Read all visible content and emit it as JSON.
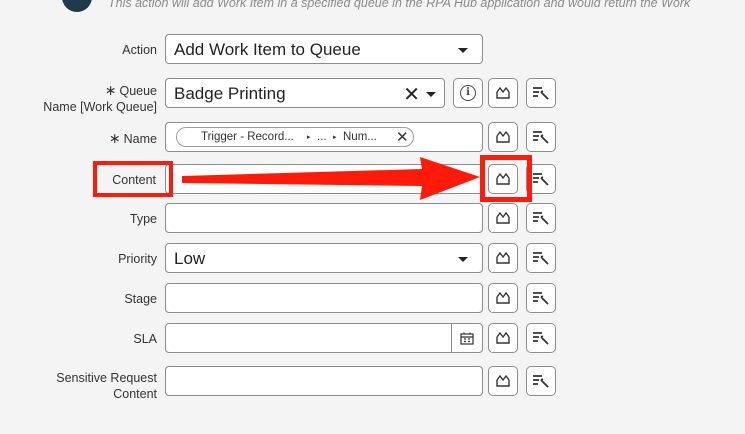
{
  "header": {
    "description": "This action will add Work Item in a specified queue in the RPA Hub application and would return the Work"
  },
  "form": {
    "action": {
      "label": "Action",
      "value": "Add Work Item to Queue"
    },
    "queue": {
      "label_line1": "Queue",
      "label_line2": "Name [Work Queue]",
      "required_mark": "∗",
      "value": "Badge Printing",
      "clear_glyph": "✕"
    },
    "name": {
      "label": "Name",
      "required_mark": "∗",
      "chip": {
        "part1": "Trigger - Record...",
        "sep": "▸",
        "part2": "...",
        "part3": "Num...",
        "remove_glyph": "✕"
      }
    },
    "content": {
      "label": "Content",
      "value": ""
    },
    "type": {
      "label": "Type",
      "value": ""
    },
    "priority": {
      "label": "Priority",
      "value": "Low"
    },
    "stage": {
      "label": "Stage",
      "value": ""
    },
    "sla": {
      "label": "SLA",
      "value": ""
    },
    "sensitive": {
      "label_line1": "Sensitive Request",
      "label_line2": "Content",
      "value": ""
    }
  },
  "annotation": {
    "color": "#ff1a0a"
  },
  "icons": {
    "info": "info-icon",
    "variable": "variable-picker-icon",
    "expression": "expression-builder-icon",
    "calendar": "calendar-icon"
  }
}
